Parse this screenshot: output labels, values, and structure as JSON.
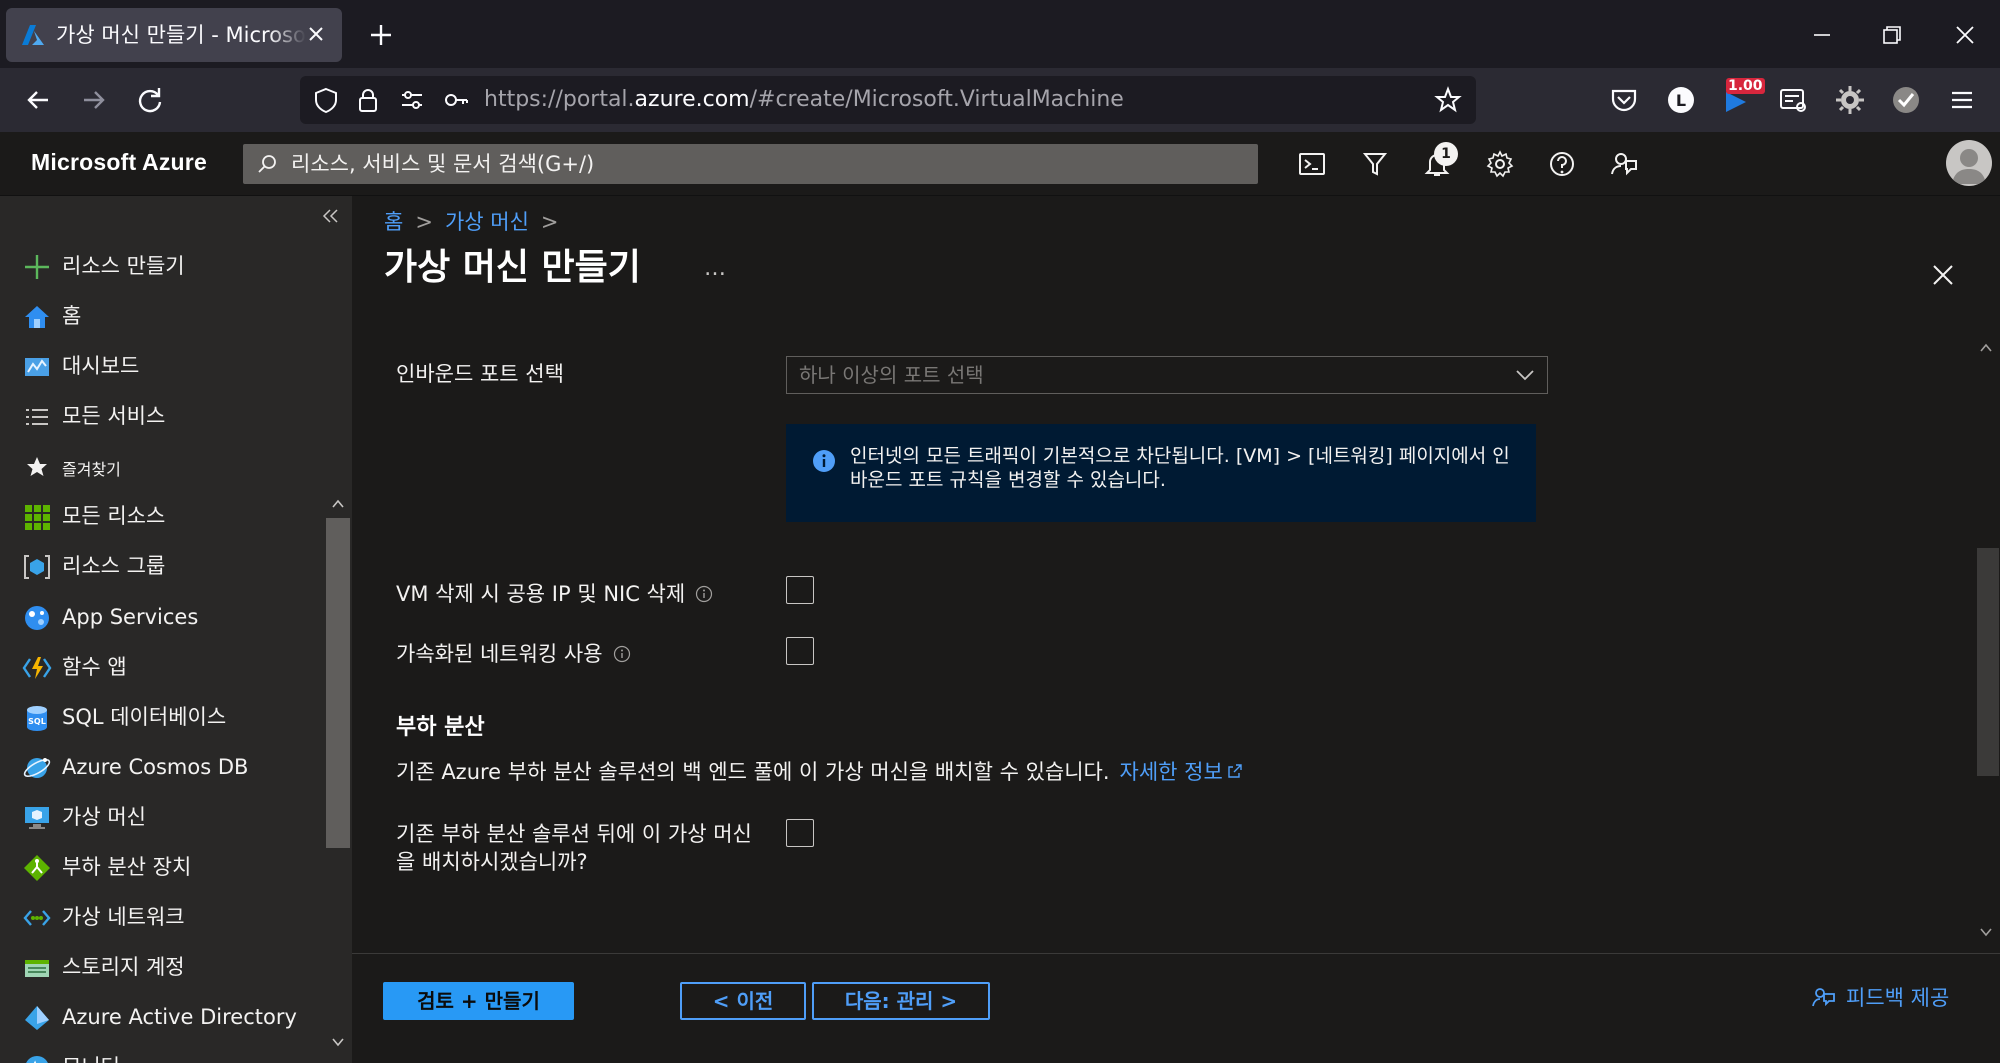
{
  "browser": {
    "tab_title": "가상 머신 만들기 - Microsoft Azure",
    "url_prefix": "https://portal.",
    "url_host": "azure.com",
    "url_path": "/#create/Microsoft.VirtualMachine",
    "extension_badge": "1.00",
    "profile_initial": "L"
  },
  "azure": {
    "brand": "Microsoft Azure",
    "search_placeholder": "리소스, 서비스 및 문서 검색(G+/)",
    "notification_count": "1"
  },
  "sidebar": {
    "items": [
      {
        "label": "리소스 만들기",
        "icon": "plus-icon"
      },
      {
        "label": "홈",
        "icon": "home-icon"
      },
      {
        "label": "대시보드",
        "icon": "dashboard-icon"
      },
      {
        "label": "모든 서비스",
        "icon": "list-icon"
      },
      {
        "label": "즐겨찾기",
        "icon": "star-icon"
      },
      {
        "label": "모든 리소스",
        "icon": "grid-icon"
      },
      {
        "label": "리소스 그룹",
        "icon": "resource-group-icon"
      },
      {
        "label": "App Services",
        "icon": "app-services-icon"
      },
      {
        "label": "함수 앱",
        "icon": "function-app-icon"
      },
      {
        "label": "SQL 데이터베이스",
        "icon": "sql-database-icon"
      },
      {
        "label": "Azure Cosmos DB",
        "icon": "cosmos-db-icon"
      },
      {
        "label": "가상 머신",
        "icon": "virtual-machine-icon"
      },
      {
        "label": "부하 분산 장치",
        "icon": "load-balancer-icon"
      },
      {
        "label": "가상 네트워크",
        "icon": "virtual-network-icon"
      },
      {
        "label": "스토리지 계정",
        "icon": "storage-account-icon"
      },
      {
        "label": "Azure Active Directory",
        "icon": "active-directory-icon"
      },
      {
        "label": "모니터",
        "icon": "monitor-icon"
      }
    ]
  },
  "page": {
    "breadcrumb": [
      "홈",
      "가상 머신"
    ],
    "title": "가상 머신 만들기",
    "ellipsis": "…",
    "inbound_ports_label": "인바운드 포트 선택",
    "inbound_ports_placeholder": "하나 이상의 포트 선택",
    "info_text": "인터넷의 모든 트래픽이 기본적으로 차단됩니다. [VM] > [네트워킹] 페이지에서 인바운드 포트 규칙을 변경할 수 있습니다.",
    "delete_ip_nic_label": "VM 삭제 시 공용 IP 및 NIC 삭제",
    "accelerated_networking_label": "가속화된 네트워킹 사용",
    "lb_section_title": "부하 분산",
    "lb_description": "기존 Azure 부하 분산 솔루션의 백 엔드 풀에 이 가상 머신을 배치할 수 있습니다.",
    "lb_learn_more": "자세한 정보",
    "lb_question_line1": "기존 부하 분산 솔루션 뒤에 이 가상 머신",
    "lb_question_line2": "을 배치하시겠습니까?",
    "checkboxes": {
      "delete_ip_nic": false,
      "accelerated_networking": false,
      "load_balancer": false
    }
  },
  "footer": {
    "review_create": "검토 + 만들기",
    "previous": "< 이전",
    "next": "다음: 관리 >",
    "feedback": "피드백 제공"
  },
  "colors": {
    "accent": "#2899f5",
    "link": "#4f9ef8",
    "info_bg": "#001a33",
    "background": "#1b1a19",
    "sidebar_bg": "#292827"
  }
}
